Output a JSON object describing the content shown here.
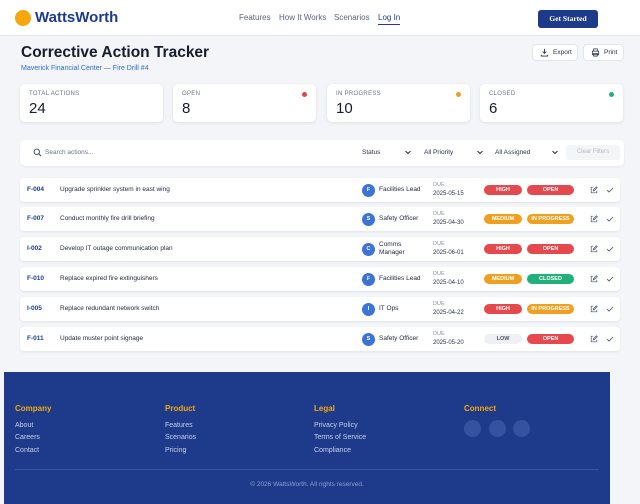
{
  "brand": {
    "name": "WattsWorth",
    "accent": "#f5a70c",
    "primary": "#1d3b8a"
  },
  "nav": {
    "features": "Features",
    "how": "How It Works",
    "scenarios": "Scenarios",
    "login": "Log In",
    "cta": "Get Started"
  },
  "page": {
    "title": "Corrective Action Tracker",
    "subtitle": "Maverick Financial Center — Fire Drill #4",
    "export": "Export",
    "print": "Print"
  },
  "stats": [
    {
      "label": "TOTAL ACTIONS",
      "value": "24"
    },
    {
      "label": "OPEN",
      "value": "8",
      "dot_color": "#e04848"
    },
    {
      "label": "IN PROGRESS",
      "value": "10",
      "dot_color": "#f0a020"
    },
    {
      "label": "CLOSED",
      "value": "6",
      "dot_color": "#22b07a"
    }
  ],
  "filters": {
    "search_placeholder": "Search actions...",
    "status": "Status",
    "priority": "All Priority",
    "assigned": "All Assigned",
    "clear": "Clear Filters"
  },
  "due_label": "DUE",
  "actions": [
    {
      "id": "F-004",
      "title": "Upgrade sprinkler system in east wing",
      "avatar": "F",
      "owner": "Facilities Lead",
      "due": "2025-05-15",
      "priority": "HIGH",
      "status": "OPEN"
    },
    {
      "id": "F-007",
      "title": "Conduct monthly fire drill briefing",
      "avatar": "S",
      "owner": "Safety Officer",
      "due": "2025-04-30",
      "priority": "MEDIUM",
      "status": "IN PROGRESS"
    },
    {
      "id": "I-002",
      "title": "Develop IT outage communication plan",
      "avatar": "C",
      "owner": "Comms Manager",
      "due": "2025-06-01",
      "priority": "HIGH",
      "status": "OPEN"
    },
    {
      "id": "F-010",
      "title": "Replace expired fire extinguishers",
      "avatar": "F",
      "owner": "Facilities Lead",
      "due": "2025-04-10",
      "priority": "MEDIUM",
      "status": "CLOSED"
    },
    {
      "id": "I-005",
      "title": "Replace redundant network switch",
      "avatar": "I",
      "owner": "IT Ops",
      "due": "2025-04-22",
      "priority": "HIGH",
      "status": "IN PROGRESS"
    },
    {
      "id": "F-011",
      "title": "Update muster point signage",
      "avatar": "S",
      "owner": "Safety Officer",
      "due": "2025-05-20",
      "priority": "LOW",
      "status": "OPEN"
    }
  ],
  "colors": {
    "high": "#e5484d",
    "medium": "#f0a020",
    "low": "#eef0f3",
    "open": "#e5484d",
    "in_progress": "#f0a020",
    "closed": "#22b07a"
  },
  "footer": {
    "company": {
      "heading": "Company",
      "links": [
        "About",
        "Careers",
        "Contact"
      ]
    },
    "product": {
      "heading": "Product",
      "links": [
        "Features",
        "Scenarios",
        "Pricing"
      ]
    },
    "legal": {
      "heading": "Legal",
      "links": [
        "Privacy Policy",
        "Terms of Service",
        "Compliance"
      ]
    },
    "connect": {
      "heading": "Connect"
    },
    "copyright": "© 2026 WattsWorth. All rights reserved."
  }
}
